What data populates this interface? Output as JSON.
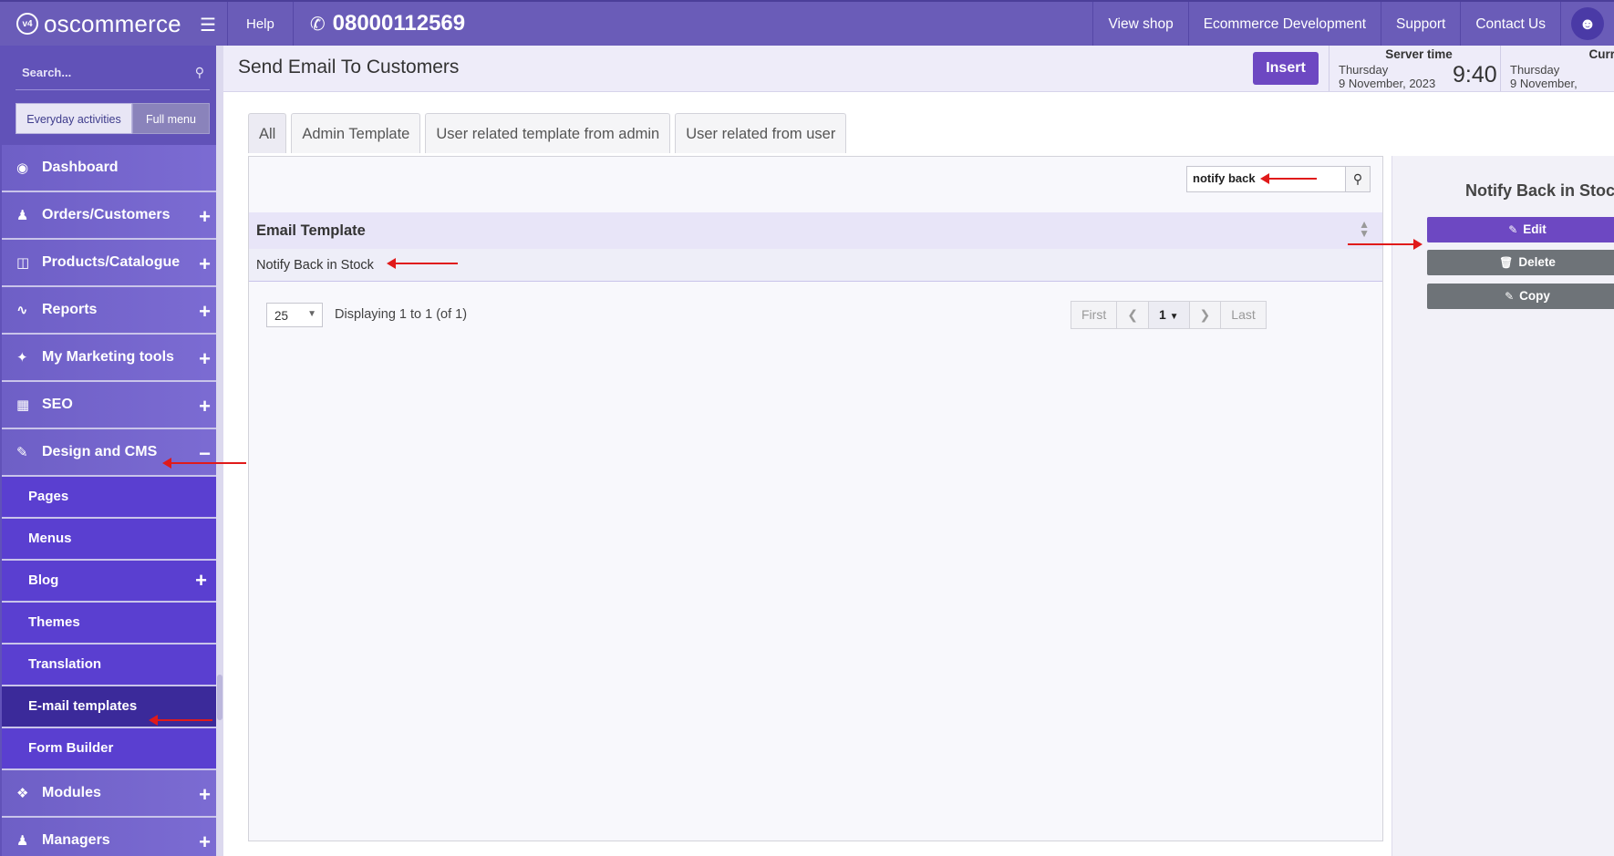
{
  "topbar": {
    "logo_text": "oscommerce",
    "logo_mark": "v4",
    "help_label": "Help",
    "phone_icon": "phone-icon",
    "phone": "08000112569",
    "nav": [
      "View shop",
      "Ecommerce Development",
      "Support",
      "Contact Us"
    ],
    "colors": {
      "bar": "#6a5cb8",
      "accent": "#6d48c2"
    }
  },
  "sidebar": {
    "search_placeholder": "Search...",
    "switch_active": "Everyday activities",
    "switch_inactive": "Full menu",
    "items": [
      {
        "label": "Dashboard",
        "icon": "dashboard-icon",
        "expandable": false
      },
      {
        "label": "Orders/Customers",
        "icon": "users-icon",
        "expandable": true
      },
      {
        "label": "Products/Catalogue",
        "icon": "folder-icon",
        "expandable": true
      },
      {
        "label": "Reports",
        "icon": "chart-icon",
        "expandable": true
      },
      {
        "label": "My Marketing tools",
        "icon": "tag-icon",
        "expandable": true
      },
      {
        "label": "SEO",
        "icon": "sitemap-icon",
        "expandable": true
      },
      {
        "label": "Design and CMS",
        "icon": "brush-icon",
        "expandable": false
      }
    ],
    "design_sub": [
      {
        "label": "Pages",
        "expandable": false,
        "active": false
      },
      {
        "label": "Menus",
        "expandable": false,
        "active": false
      },
      {
        "label": "Blog",
        "expandable": true,
        "active": false
      },
      {
        "label": "Themes",
        "expandable": false,
        "active": false
      },
      {
        "label": "Translation",
        "expandable": false,
        "active": false
      },
      {
        "label": "E-mail templates",
        "expandable": false,
        "active": true
      },
      {
        "label": "Form Builder",
        "expandable": false,
        "active": false
      }
    ],
    "after": [
      {
        "label": "Modules",
        "icon": "puzzle-icon",
        "expandable": true
      },
      {
        "label": "Managers",
        "icon": "manager-icon",
        "expandable": true
      }
    ]
  },
  "header": {
    "title": "Send Email To Customers",
    "insert_label": "Insert",
    "server_time": {
      "label": "Server time",
      "day": "Thursday",
      "date": "9 November, 2023",
      "clock": "9:40"
    },
    "current_time": {
      "label": "Curr",
      "day": "Thursday",
      "date": "9 November,"
    }
  },
  "tabs": [
    "All",
    "Admin Template",
    "User related template from admin",
    "User related from user"
  ],
  "filter": {
    "value": "notify back"
  },
  "table": {
    "header": "Email Template",
    "rows": [
      "Notify Back in Stock"
    ]
  },
  "pagination": {
    "per_page": "25",
    "displaying": "Displaying 1 to 1 (of 1)",
    "first": "First",
    "current": "1",
    "last": "Last"
  },
  "right_panel": {
    "title": "Notify Back in Stock",
    "edit_label": "Edit",
    "delete_label": "Delete",
    "copy_label": "Copy"
  }
}
